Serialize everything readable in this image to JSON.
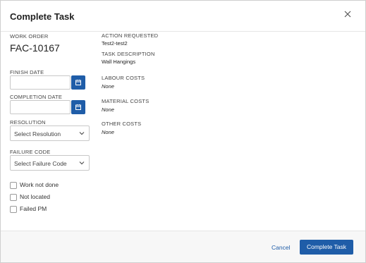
{
  "dialog": {
    "title": "Complete Task",
    "close_icon": "close-icon"
  },
  "work_order": {
    "label": "WORK ORDER",
    "value": "FAC-10167"
  },
  "finish_date": {
    "label": "FINISH DATE",
    "value": "",
    "icon": "calendar-icon"
  },
  "completion_date": {
    "label": "COMPLETION DATE",
    "value": "",
    "icon": "calendar-icon"
  },
  "resolution": {
    "label": "RESOLUTION",
    "selected": "Select Resolution"
  },
  "failure_code": {
    "label": "FAILURE CODE",
    "selected": "Select Failure Code"
  },
  "checkboxes": [
    {
      "label": "Work not done",
      "checked": false
    },
    {
      "label": "Not located",
      "checked": false
    },
    {
      "label": "Failed PM",
      "checked": false
    }
  ],
  "details": {
    "action_requested_label": "ACTION REQUESTED",
    "action_requested_value": "Test2-test2",
    "task_description_label": "TASK DESCRIPTION",
    "task_description_value": "Wall Hangings",
    "labour_costs_label": "LABOUR COSTS",
    "labour_costs_value": "None",
    "material_costs_label": "MATERIAL COSTS",
    "material_costs_value": "None",
    "other_costs_label": "OTHER COSTS",
    "other_costs_value": "None"
  },
  "footer": {
    "cancel_label": "Cancel",
    "complete_label": "Complete Task"
  },
  "colors": {
    "primary": "#1f5da8",
    "text": "#222222",
    "border": "#c8c8c8"
  }
}
